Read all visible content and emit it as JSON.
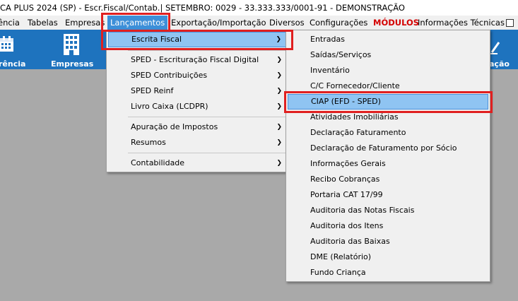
{
  "title_bar": {
    "text": "CA PLUS 2024 (SP) - Escr.Fiscal/Contab.| SETEMBRO: 0029 - 33.333.333/0001-91 - DEMONSTRAÇÃO"
  },
  "menubar": {
    "items": [
      "ência",
      "Tabelas",
      "Empresas",
      "Lançamentos",
      "Exportação/Importação",
      "Diversos",
      "Configurações",
      "MÓDULOS",
      "Informações Técnicas"
    ],
    "active": "Lançamentos",
    "highlight_color": "#e02020"
  },
  "toolbar": {
    "buttons": [
      {
        "label": "rência",
        "icon": "calendar-icon"
      },
      {
        "label": "Empresas",
        "icon": "building-icon"
      },
      {
        "label": "ação",
        "icon": "edit-icon"
      }
    ],
    "background": "#1e73be"
  },
  "menu_lancamentos": {
    "items": [
      {
        "label": "Escrita Fiscal",
        "has_submenu": true,
        "highlighted": true
      },
      {
        "label": "SPED - Escrituração Fiscal Digital",
        "has_submenu": true
      },
      {
        "label": "SPED Contribuições",
        "has_submenu": true
      },
      {
        "label": "SPED Reinf",
        "has_submenu": true
      },
      {
        "label": "Livro Caixa (LCDPR)",
        "has_submenu": true
      },
      {
        "label": "Apuração de Impostos",
        "has_submenu": true
      },
      {
        "label": "Resumos",
        "has_submenu": true
      },
      {
        "label": "Contabilidade",
        "has_submenu": true
      }
    ],
    "arrow": "❯"
  },
  "menu_escrita_fiscal": {
    "items": [
      "Entradas",
      "Saídas/Serviços",
      "Inventário",
      "C/C Fornecedor/Cliente",
      "CIAP (EFD - SPED)",
      "Atividades Imobiliárias",
      "Declaração Faturamento",
      "Declaração de Faturamento por Sócio",
      "Informações Gerais",
      "Recibo Cobranças",
      "Portaria CAT 17/99",
      "Auditoria das Notas Fiscais",
      "Auditoria dos Itens",
      "Auditoria das Baixas",
      "DME (Relatório)",
      "Fundo Criança"
    ],
    "highlighted": "CIAP (EFD - SPED)"
  }
}
